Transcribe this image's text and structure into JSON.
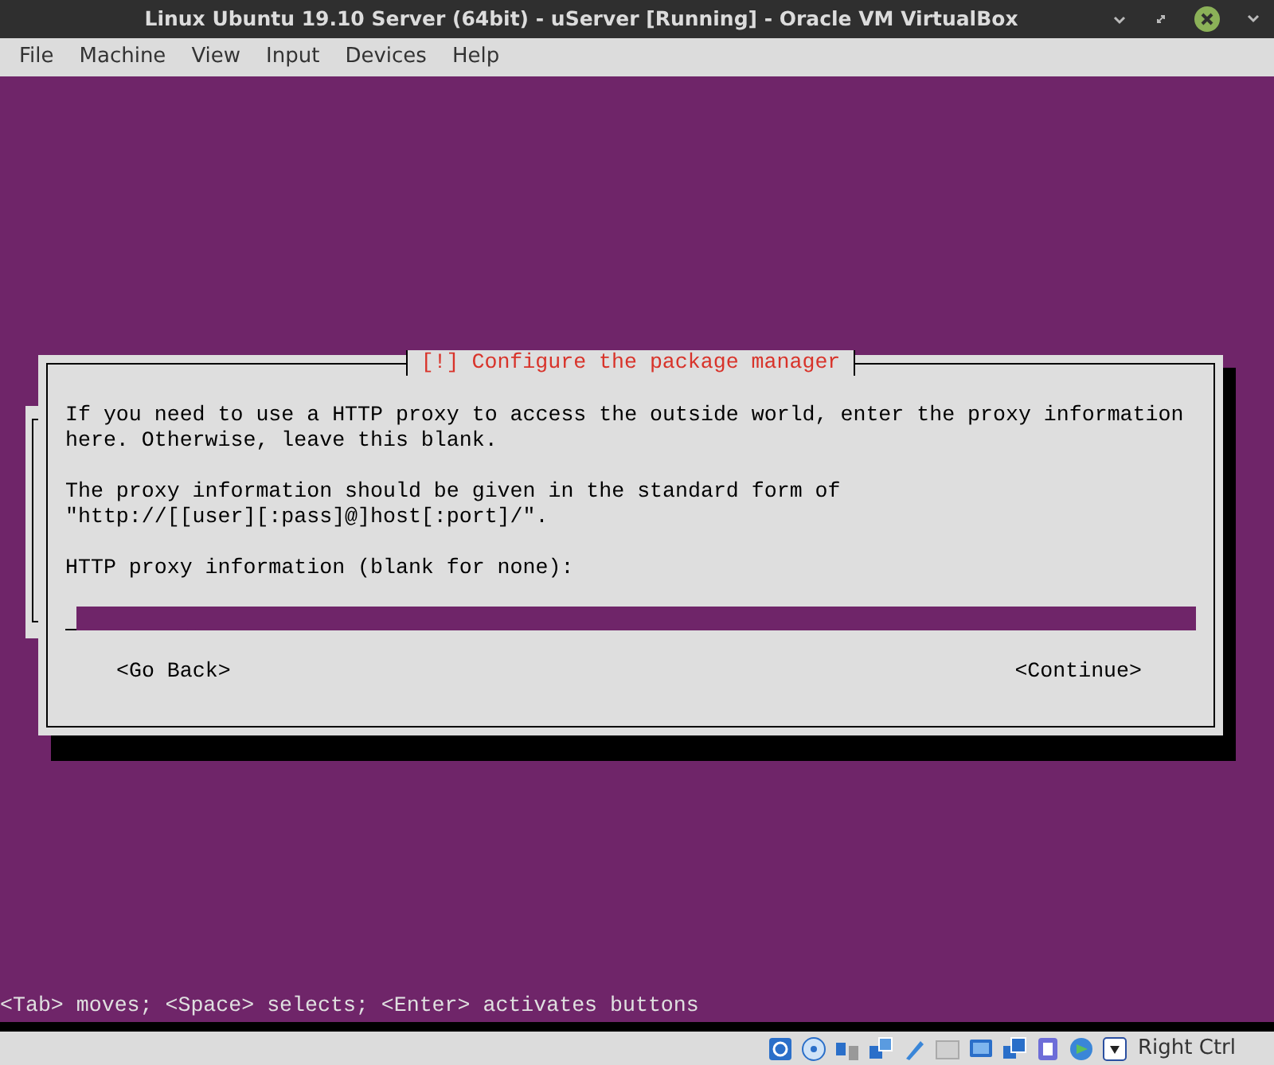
{
  "window": {
    "title": "Linux Ubuntu 19.10 Server (64bit) - uServer [Running] - Oracle VM VirtualBox"
  },
  "menu": [
    "File",
    "Machine",
    "View",
    "Input",
    "Devices",
    "Help"
  ],
  "dialog": {
    "title": "[!] Configure the package manager",
    "paragraphs": [
      [
        "If you need to use a HTTP proxy to access the outside world, enter the proxy information",
        "here. Otherwise, leave this blank."
      ],
      [
        "The proxy information should be given in the standard form of",
        "\"http://[[user][:pass]@]host[:port]/\"."
      ]
    ],
    "field_label": "HTTP proxy information (blank for none):",
    "buttons": [
      "<Go Back>",
      "<Continue>"
    ]
  },
  "hint": "<Tab> moves; <Space> selects; <Enter> activates buttons",
  "status_bar": {
    "host_key": "Right Ctrl"
  }
}
